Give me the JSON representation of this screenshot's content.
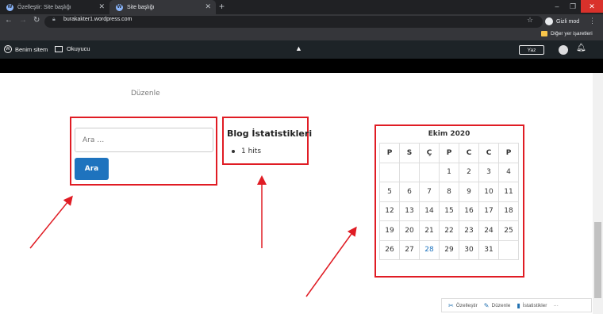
{
  "browser": {
    "tabs": [
      {
        "title": "Özelleştir: Site başlığı",
        "active": false
      },
      {
        "title": "Site başlığı",
        "active": true
      }
    ],
    "new_tab": "+",
    "window_controls": {
      "minimize": "–",
      "restore": "❐",
      "close": "✕"
    },
    "url": "burakakter1.wordpress.com",
    "incognito_label": "Gizli mod",
    "other_bookmarks": "Diğer yer işaretleri",
    "menu_icon": "⋮"
  },
  "admin_bar": {
    "my_site": "Benim sitem",
    "reader": "Okuyucu",
    "write": "Yaz"
  },
  "page": {
    "edit_link": "Düzenle",
    "search": {
      "placeholder": "Ara …",
      "button_label": "Ara"
    },
    "stats_widget": {
      "title": "Blog İstatistikleri",
      "items": [
        "1 hits"
      ]
    },
    "calendar": {
      "caption": "Ekim 2020",
      "weekdays": [
        "P",
        "S",
        "Ç",
        "P",
        "C",
        "C",
        "P"
      ],
      "weeks": [
        [
          "",
          "",
          "",
          "1",
          "2",
          "3",
          "4"
        ],
        [
          "5",
          "6",
          "7",
          "8",
          "9",
          "10",
          "11"
        ],
        [
          "12",
          "13",
          "14",
          "15",
          "16",
          "17",
          "18"
        ],
        [
          "19",
          "20",
          "21",
          "22",
          "23",
          "24",
          "25"
        ],
        [
          "26",
          "27",
          "28",
          "29",
          "30",
          "31",
          ""
        ]
      ],
      "highlighted_day": "28"
    }
  },
  "bottom_toolbar": {
    "customize": "Özelleştir",
    "edit": "Düzenle",
    "stats": "İstatistikler",
    "more": "···"
  },
  "colors": {
    "annotation_red": "#e01c24",
    "button_blue": "#1e73be",
    "admin_bar": "#1d2327"
  }
}
